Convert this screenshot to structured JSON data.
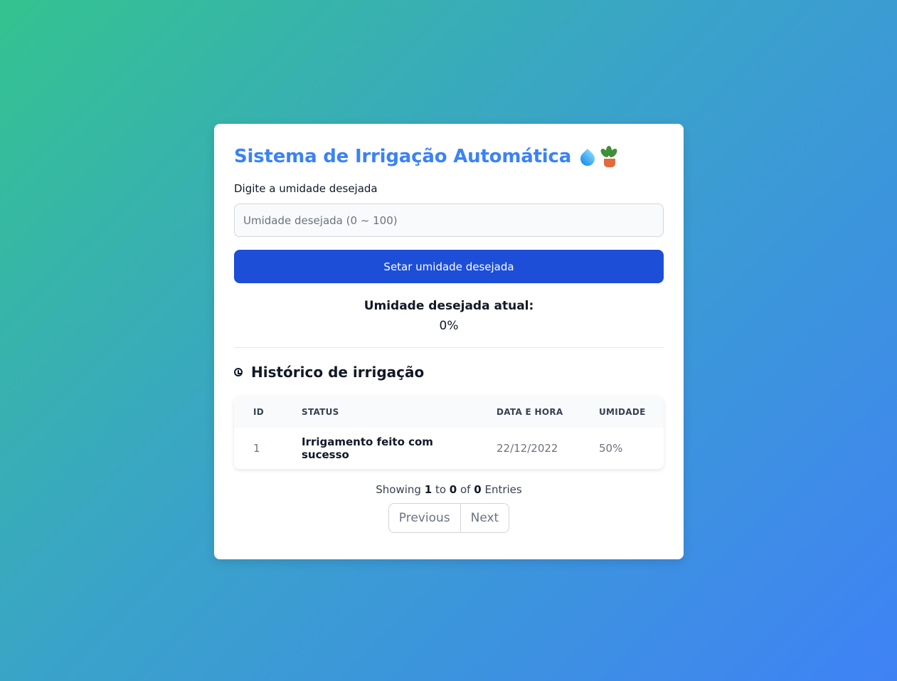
{
  "header": {
    "title": "Sistema de Irrigação Automática"
  },
  "form": {
    "label": "Digite a umidade desejada",
    "input_placeholder": "Umidade desejada (0 ~ 100)",
    "input_value": "",
    "submit_label": "Setar umidade desejada"
  },
  "current": {
    "title": "Umidade desejada atual:",
    "value": "0%"
  },
  "history": {
    "title": "Histórico de irrigação",
    "columns": [
      "ID",
      "STATUS",
      "DATA E HORA",
      "UMIDADE"
    ],
    "rows": [
      {
        "id": "1",
        "status": "Irrigamento feito com sucesso",
        "date": "22/12/2022",
        "humidity": "50%"
      }
    ]
  },
  "pagination": {
    "showing_prefix": "Showing",
    "from": "1",
    "to_word": "to",
    "to": "0",
    "of_word": "of",
    "total": "0",
    "entries_word": "Entries",
    "prev_label": "Previous",
    "next_label": "Next"
  },
  "colors": {
    "title": "#3b82f6",
    "primary_button": "#1d4ed8",
    "gradient_start": "#34c38f",
    "gradient_end": "#3f82f5"
  },
  "icons": [
    "water-drop-icon",
    "potted-plant-icon",
    "history-clock-icon"
  ]
}
